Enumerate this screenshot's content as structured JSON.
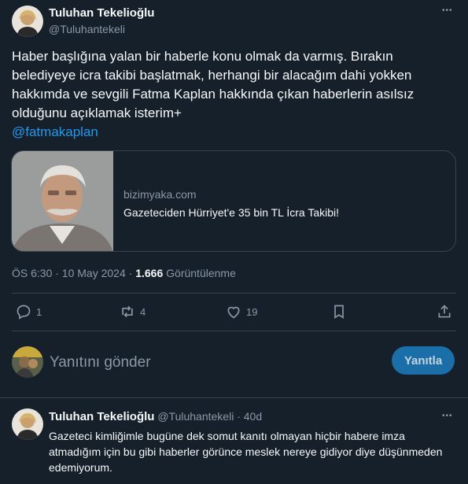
{
  "tweet": {
    "author_name": "Tuluhan Tekelioğlu",
    "author_handle": "@Tuluhantekeli",
    "more_icon": "•••",
    "text": "Haber başlığına yalan bir haberle konu olmak da varmış. Bırakın belediyeye icra takibi başlatmak, herhangi bir alacağım dahi yokken hakkımda ve sevgili Fatma Kaplan hakkında çıkan haberlerin asılsız olduğunu açıklamak isterim+",
    "mention": "@fatmakaplan",
    "card": {
      "domain": "bizimyaka.com",
      "title": "Gazeteciden Hürriyet'e 35 bin TL İcra Takibi!"
    },
    "meta": {
      "time": "ÖS 6:30 · 10 May 2024 · ",
      "views_count": "1.666",
      "views_label": " Görüntülenme"
    },
    "actions": {
      "replies": "1",
      "retweets": "4",
      "likes": "19",
      "icons": [
        "reply-icon",
        "retweet-icon",
        "like-icon",
        "bookmark-icon",
        "share-icon"
      ]
    }
  },
  "composer": {
    "placeholder": "Yanıtını gönder",
    "button_label": "Yanıtla"
  },
  "reply": {
    "author_name": "Tuluhan Tekelioğlu",
    "author_handle": "@Tuluhantekeli",
    "age": "40d",
    "text": "Gazeteci kimliğimle bugüne dek somut kanıtı olmayan hiçbir habere imza atmadığım için bu gibi haberler görünce meslek nereye gidiyor diye düşünmeden edemiyorum."
  },
  "colors": {
    "background": "#15202b",
    "accent": "#1d9bf0",
    "muted": "#8b98a5",
    "border": "#38444d"
  }
}
